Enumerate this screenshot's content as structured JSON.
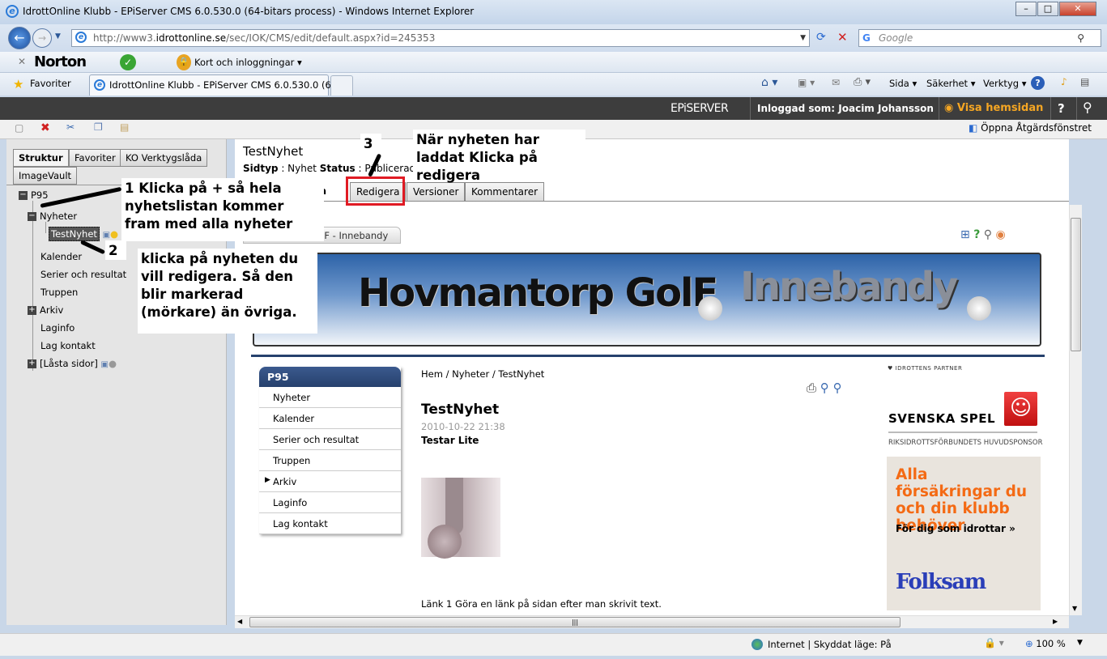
{
  "window": {
    "title": "IdrottOnline Klubb - EPiServer CMS 6.0.530.0 (64-bitars process) - Windows Internet Explorer"
  },
  "address": {
    "url_prefix": "http://www3.",
    "url_domain": "idrottonline.se",
    "url_path": "/sec/IOK/CMS/edit/default.aspx?id=245353",
    "search_placeholder": "Google"
  },
  "norton": {
    "brand": "Norton",
    "cards": "Kort och inloggningar"
  },
  "favorites": {
    "label": "Favoriter",
    "tab": "IdrottOnline Klubb - EPiServer CMS 6.0.530.0 (64-...",
    "commands": [
      "Sida",
      "Säkerhet",
      "Verktyg"
    ]
  },
  "episerver": {
    "logo": "EPiSERVER",
    "logged_in": "Inloggad som: Joacim Johansson",
    "view_site": "Visa hemsidan",
    "help": "?"
  },
  "toolbar": {
    "action_window": "Öppna Åtgärdsfönstret"
  },
  "left": {
    "tabs": [
      "Struktur",
      "Favoriter",
      "KO Verktygslåda",
      "ImageVault"
    ],
    "tree": {
      "root": "P95",
      "nyheter": "Nyheter",
      "selected": "TestNyhet",
      "items": [
        "Kalender",
        "Serier och resultat",
        "Truppen",
        "Arkiv",
        "Laginfo",
        "Lag kontakt",
        "[Låsta sidor]"
      ]
    }
  },
  "page": {
    "title": "TestNyhet",
    "sidtyp_label": "Sidtyp",
    "sidtyp": "Nyhet",
    "status_label": "Status",
    "status": "Publicerad v",
    "tabs": [
      "ka",
      "Redigera",
      "Versioner",
      "Kommentarer"
    ]
  },
  "preview": {
    "site_tab": "IF - Innebandy",
    "banner_title": "Hovmantorp GolF",
    "banner_sub": "Innebandy",
    "nav_header": "P95",
    "nav": [
      "Nyheter",
      "Kalender",
      "Serier och resultat",
      "Truppen",
      "Arkiv",
      "Laginfo",
      "Lag kontakt"
    ],
    "breadcrumb": "Hem / Nyheter / TestNyhet",
    "article_title": "TestNyhet",
    "date": "2010-10-22 21:38",
    "intro": "Testar Lite",
    "body": "Länk 1 Göra en länk på sidan efter man skrivit text.",
    "partner": "IDROTTENS PARTNER",
    "sponsor1": "SVENSKA SPEL",
    "sponsor1_sub": "RIKSIDROTTSFÖRBUNDETS HUVUDSPONSOR",
    "ad_headline": "Alla försäkringar du och din klubb behöver",
    "ad_sub": "För dig som idrottar »",
    "ad_brand": "Folksam"
  },
  "annotations": {
    "a1_num": "1",
    "a1": "Klicka på  + så hela nyhetslistan kommer fram med alla nyheter",
    "a2_num": "2",
    "a2": "klicka på nyheten du vill redigera. Så den blir markerad (mörkare) än övriga.",
    "a3_num": "3",
    "a3": "När nyheten har laddat Klicka på redigera"
  },
  "status": {
    "zone": "Internet | Skyddat läge: På",
    "zoom": "100 %"
  },
  "colors": {
    "highlight": "#e01b24",
    "orange": "#f5a623",
    "epi_bar": "#3d3d3d"
  }
}
